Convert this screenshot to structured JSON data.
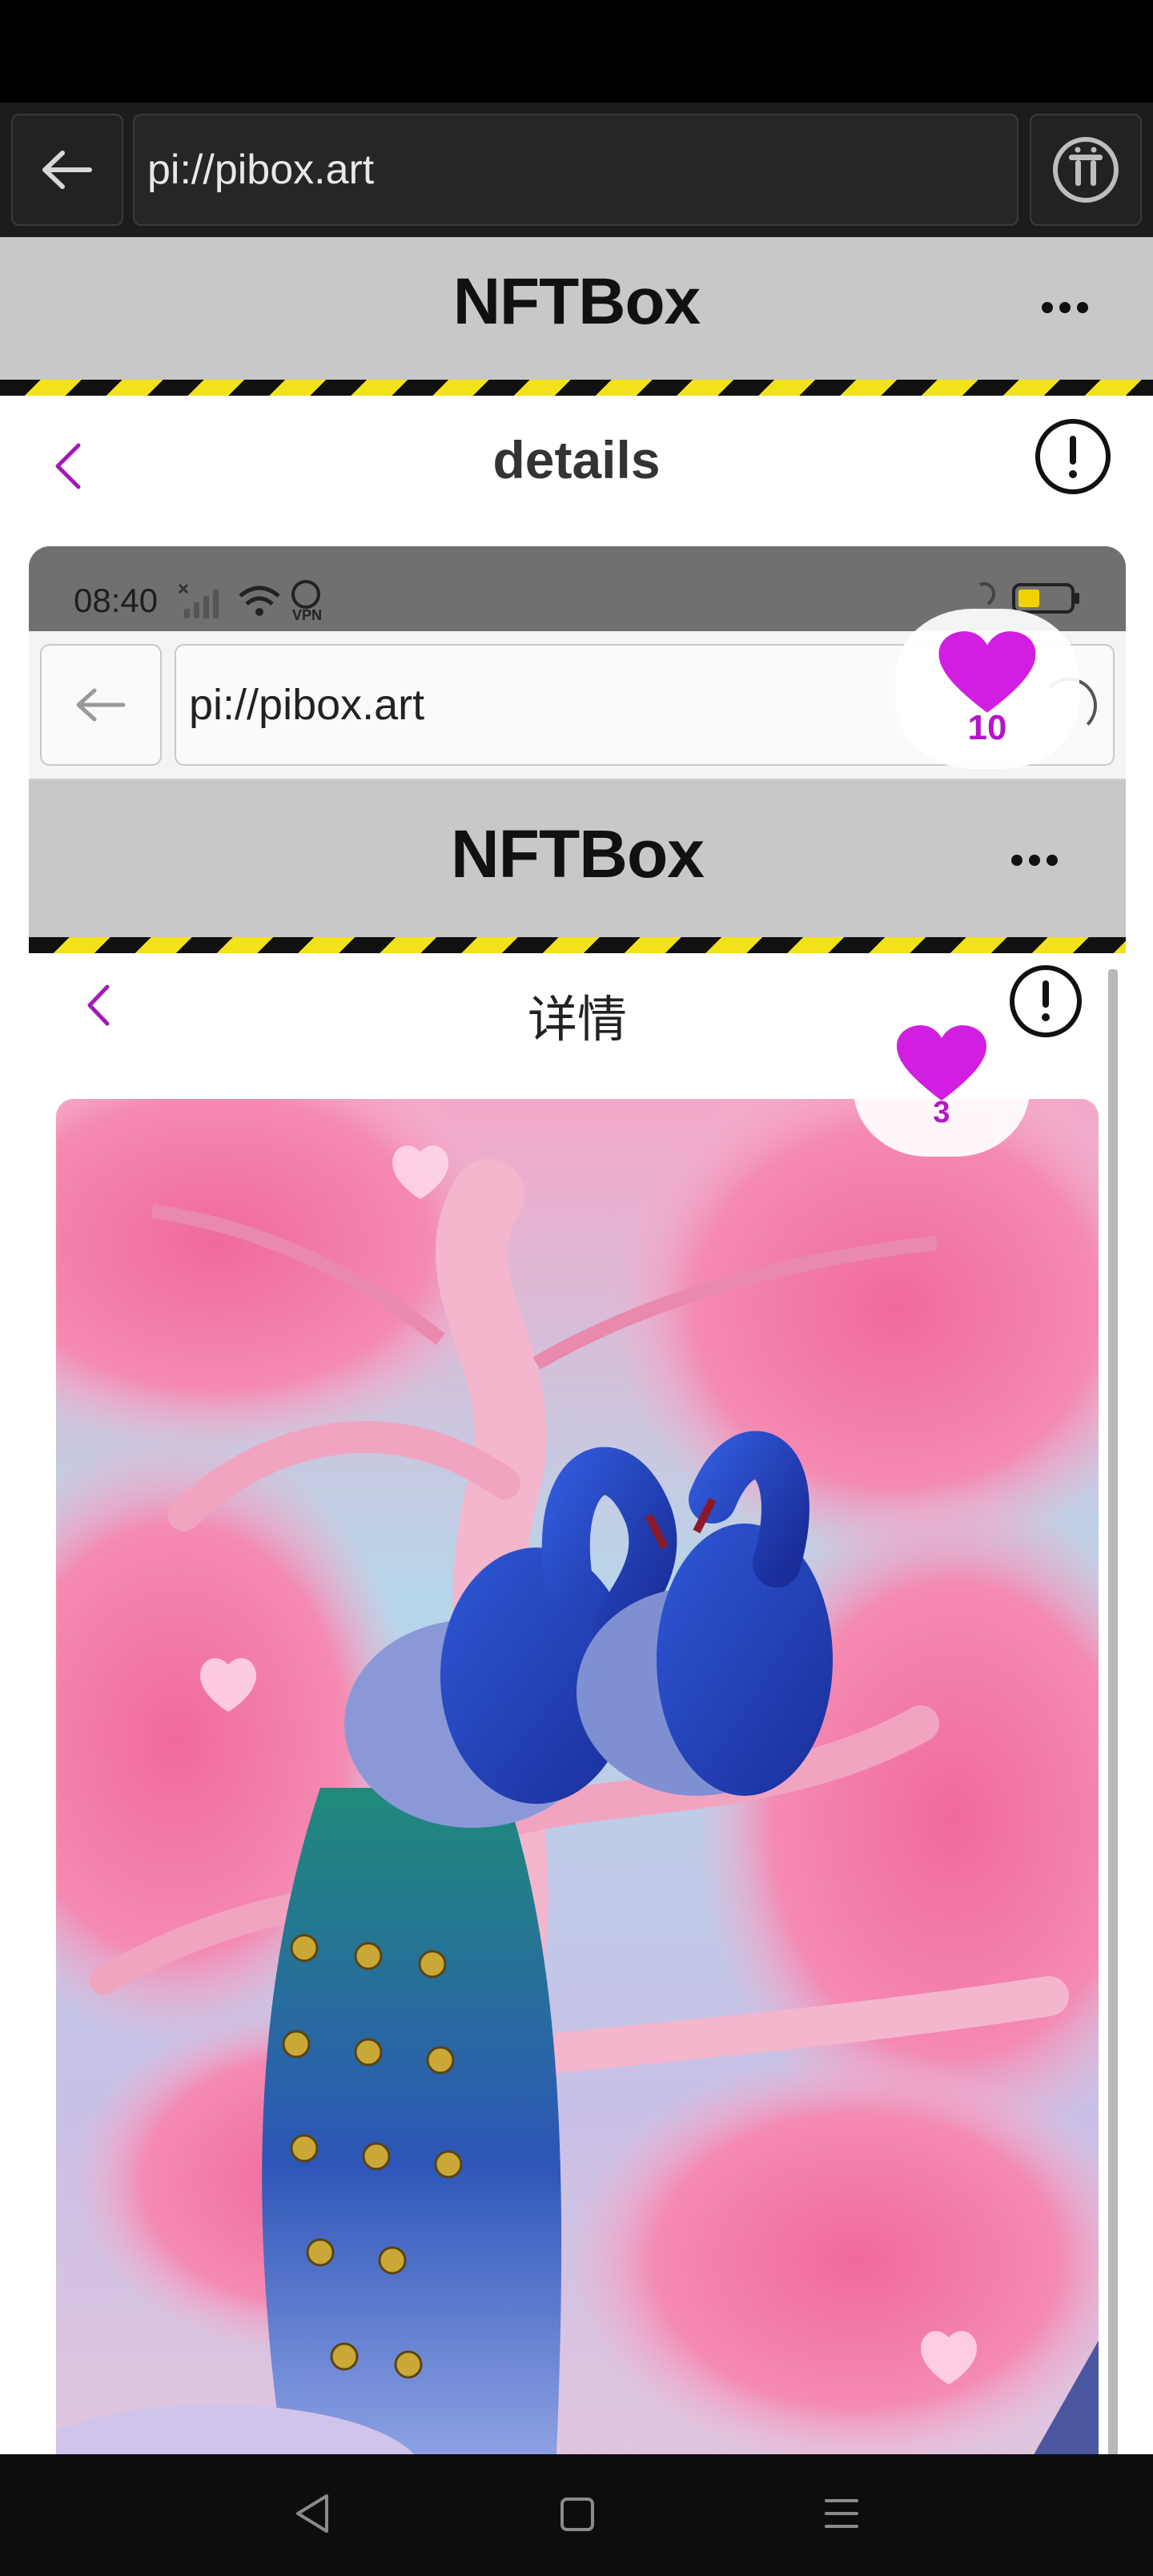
{
  "browser": {
    "url": "pi://pibox.art"
  },
  "app": {
    "title": "NFTBox"
  },
  "page": {
    "title": "details"
  },
  "screenshot": {
    "status_time": "08:40",
    "url": "pi://pibox.art",
    "app_title": "NFTBox",
    "page_title": "详情",
    "artwork_like_count": "3"
  },
  "likes": {
    "count": "10"
  },
  "colors": {
    "accent": "#b516c7",
    "heart": "#d21ee0",
    "header_bg": "#c8c8c8",
    "hazard_yellow": "#f2e21a"
  },
  "icons": [
    "back-arrow-icon",
    "pi-network-icon",
    "more-dots-icon",
    "chevron-left-icon",
    "exclamation-circle-icon",
    "heart-icon",
    "nav-back-triangle-icon",
    "nav-home-square-icon",
    "nav-menu-icon"
  ]
}
